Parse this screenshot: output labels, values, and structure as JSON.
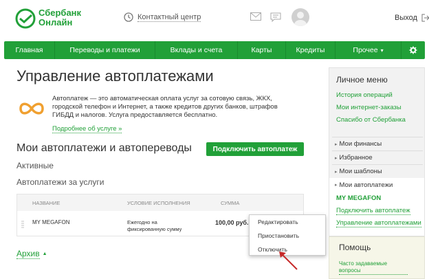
{
  "header": {
    "logo_line1": "Сбербанк",
    "logo_line2": "Онлайн",
    "contact_label": "Контактный центр",
    "exit_label": "Выход"
  },
  "nav": {
    "items": [
      {
        "label": "Главная"
      },
      {
        "label": "Переводы и платежи"
      },
      {
        "label": "Вклады и счета"
      },
      {
        "label": "Карты"
      },
      {
        "label": "Кредиты"
      },
      {
        "label": "Прочее"
      }
    ],
    "more_caret": "▾"
  },
  "main": {
    "title": "Управление автоплатежами",
    "info_text": "Автоплатеж — это автоматическая оплата услуг за сотовую связь, ЖКХ, городской телефон и Интернет, а также кредитов других банков, штрафов ГИБДД и налогов. Услуга предоставляется бесплатно.",
    "info_link": "Подробнее об услуге »",
    "section_title": "Мои автоплатежи и автопереводы",
    "connect_button": "Подключить автоплатеж",
    "active_label": "Активные",
    "services_label": "Автоплатежи за услуги",
    "table": {
      "headers": [
        "НАЗВАНИЕ",
        "УСЛОВИЕ ИСПОЛНЕНИЯ",
        "СУММА"
      ],
      "row": {
        "name": "MY MEGAFON",
        "condition_line1": "Ежегодно на",
        "condition_line2": "фиксированную сумму",
        "amount": "100,00 руб."
      }
    },
    "archive_label": "Архив",
    "archive_caret": "▲"
  },
  "menu": {
    "items": [
      "Редактировать",
      "Приостановить",
      "Отключить"
    ]
  },
  "sidebar": {
    "title": "Личное меню",
    "links": [
      "История операций",
      "Мои интернет-заказы",
      "Спасибо от Сбербанка"
    ],
    "sections": [
      "Мои финансы",
      "Избранное",
      "Мои шаблоны",
      "Мои автоплатежи"
    ],
    "section_caret": "▸",
    "sub_items": [
      "MY MEGAFON",
      "Подключить автоплатеж",
      "Управление автоплатежами"
    ]
  },
  "help": {
    "title": "Помощь",
    "link": "Часто задаваемые вопросы"
  },
  "colors": {
    "brand_green": "#21a038",
    "arrow_red": "#c62828"
  }
}
